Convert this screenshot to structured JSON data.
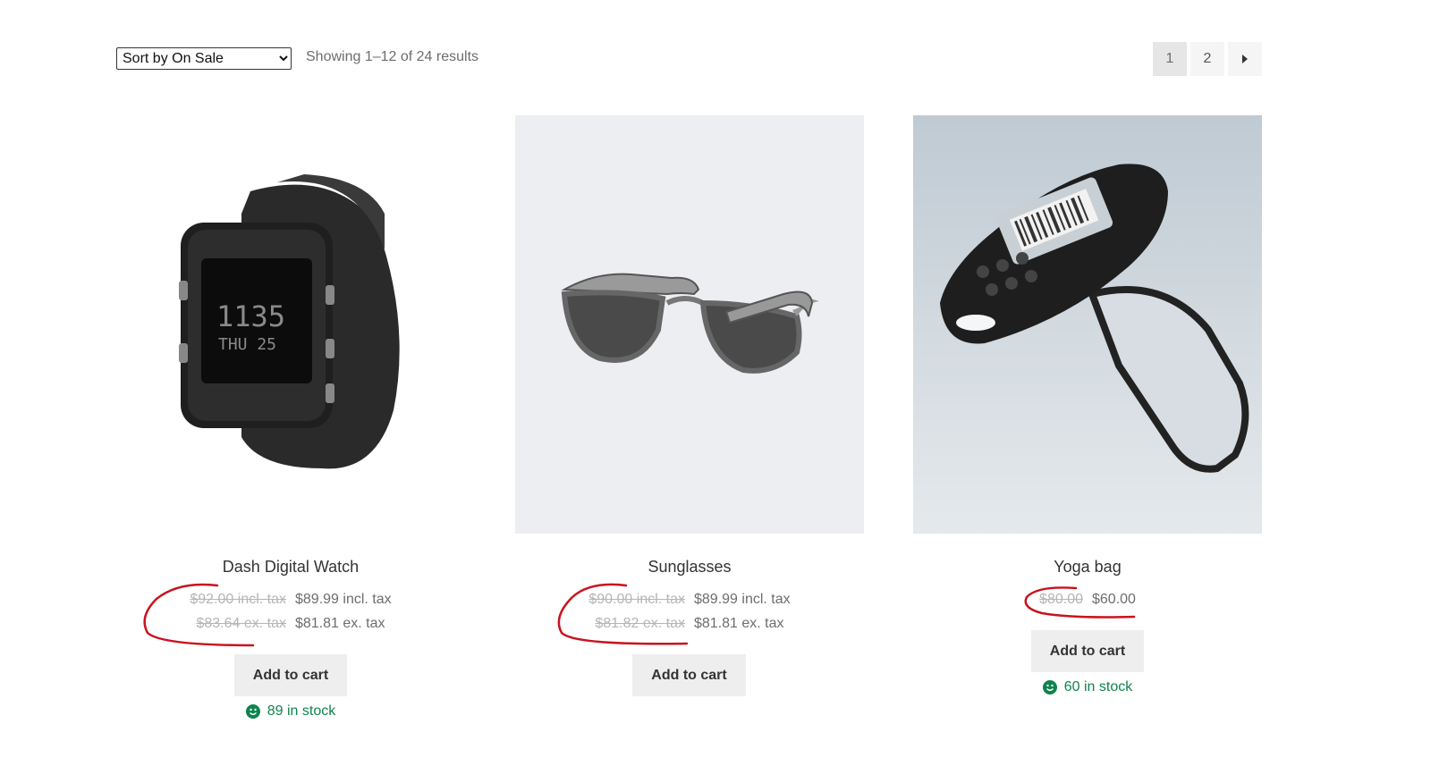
{
  "toolbar": {
    "sort_selected": "Sort by On Sale",
    "result_count": "Showing 1–12 of 24 results",
    "pages": [
      "1",
      "2"
    ],
    "next_icon": "caret-right-icon"
  },
  "products": [
    {
      "title": "Dash Digital Watch",
      "old_incl": "$92.00 incl. tax",
      "new_incl": "$89.99 incl. tax",
      "old_ex": "$83.64 ex. tax",
      "new_ex": "$81.81 ex. tax",
      "button": "Add to cart",
      "stock": "89 in stock"
    },
    {
      "title": "Sunglasses",
      "old_incl": "$90.00 incl. tax",
      "new_incl": "$89.99 incl. tax",
      "old_ex": "$81.82 ex. tax",
      "new_ex": "$81.81 ex. tax",
      "button": "Add to cart"
    },
    {
      "title": "Yoga bag",
      "old_price": "$80.00",
      "new_price": "$60.00",
      "button": "Add to cart",
      "stock": "60 in stock"
    }
  ],
  "colors": {
    "stock_green": "#0f834d",
    "annotation_red": "#c8141e",
    "button_bg": "#eeeeee"
  }
}
